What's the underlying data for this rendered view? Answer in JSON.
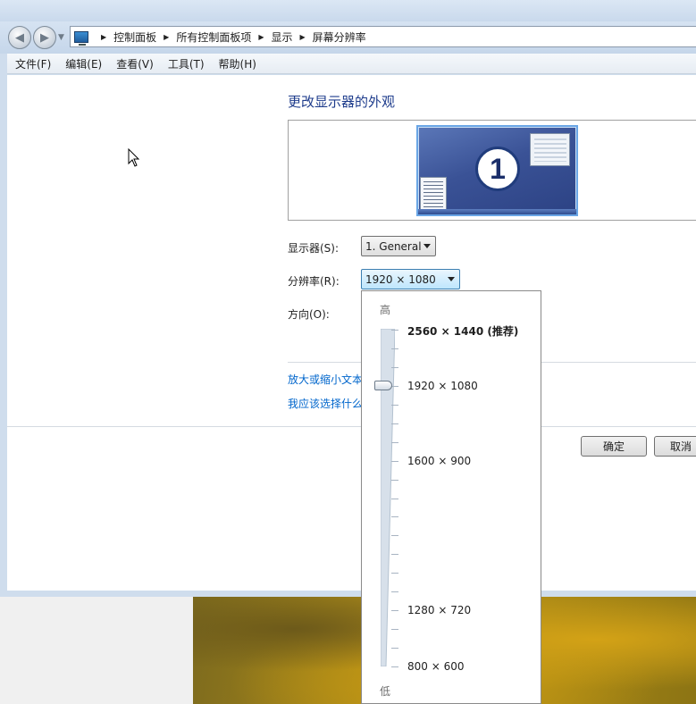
{
  "address_bar": {
    "crumbs": [
      "控制面板",
      "所有控制面板项",
      "显示",
      "屏幕分辨率"
    ]
  },
  "menu": [
    "文件(F)",
    "编辑(E)",
    "查看(V)",
    "工具(T)",
    "帮助(H)"
  ],
  "heading": "更改显示器的外观",
  "monitor_number": "1",
  "fields": {
    "display_label": "显示器(S):",
    "display_value": "1. General",
    "resolution_label": "分辨率(R):",
    "resolution_value": "1920 × 1080",
    "orientation_label": "方向(O):"
  },
  "links": {
    "zoom": "放大或缩小文本",
    "which": "我应该选择什么"
  },
  "buttons": {
    "ok": "确定",
    "cancel": "取消"
  },
  "slider": {
    "high_label": "高",
    "low_label": "低",
    "selected": "1920 × 1080",
    "options": [
      {
        "label": "2560 × 1440 (推荐)",
        "recommended": true
      },
      {
        "label": "1920 × 1080",
        "recommended": false
      },
      {
        "label": "1600 × 900",
        "recommended": false
      },
      {
        "label": "1280 × 720",
        "recommended": false
      },
      {
        "label": "800 × 600",
        "recommended": false
      }
    ]
  },
  "colors": {
    "heading": "#1e3c8c",
    "link": "#0066cc"
  }
}
